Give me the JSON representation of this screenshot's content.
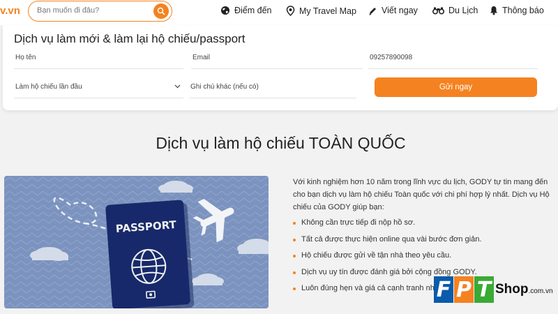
{
  "header": {
    "logo_fragment": "v.vn",
    "search_placeholder": "Bạn muốn đi đâu?",
    "nav": [
      {
        "label": "Điểm đến",
        "icon": "globe-icon"
      },
      {
        "label": "My Travel Map",
        "icon": "map-pin-icon"
      },
      {
        "label": "Viết ngay",
        "icon": "pencil-icon"
      },
      {
        "label": "Du Lịch",
        "icon": "binoculars-icon"
      },
      {
        "label": "Thông báo",
        "icon": "bell-icon"
      }
    ]
  },
  "form": {
    "title": "Dịch vụ làm mới & làm lại hộ chiếu/passport",
    "name_placeholder": "Họ tên",
    "email_placeholder": "Email",
    "phone_value": "09257890098",
    "type_select": "Làm hộ chiếu lần đầu",
    "note_placeholder": "Ghi chú khác (nếu có)",
    "submit_label": "Gửi ngay"
  },
  "section": {
    "title": "Dịch vụ làm hộ chiếu TOÀN QUỐC",
    "passport_text": "PASSPORT",
    "description": "Với kinh nghiệm hơn 10 năm trong lĩnh vực du lịch, GODY tự tin mang đến cho bạn dịch vụ làm hộ chiếu Toàn quốc với chi phí hợp lý nhất. Dịch vụ Hộ chiếu của GODY giúp bạn:",
    "bullets": [
      "Không cần trực tiếp đi nộp hồ sơ.",
      "Tất cả được thực hiện online qua vài bước đơn giản.",
      "Hộ chiếu được gửi về tận nhà theo yêu cầu.",
      "Dịch vụ uy tín được đánh giá bởi cộng đồng GODY.",
      "Luôn đúng hẹn và giá cả cạnh tranh nhất."
    ]
  },
  "watermark": {
    "letters": [
      "F",
      "P",
      "T"
    ],
    "shop": "Shop",
    "domain": ".com.vn",
    "colors": [
      "#0a5bab",
      "#f58220",
      "#3aaa35"
    ]
  },
  "colors": {
    "accent": "#f58220",
    "passport_blue": "#17296b",
    "hero_bg": "#7c94bf"
  }
}
